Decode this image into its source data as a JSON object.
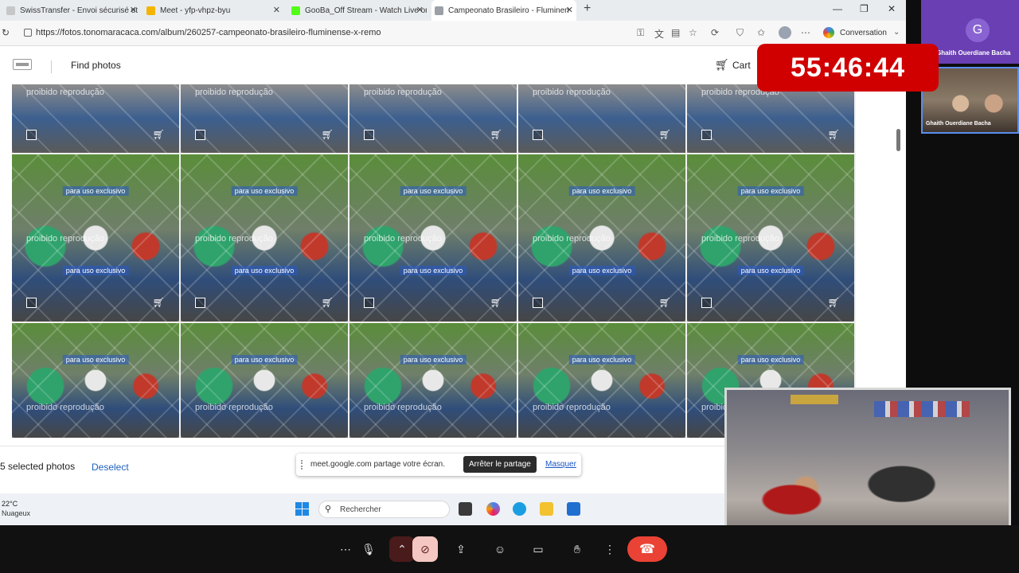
{
  "browser": {
    "tabs": [
      {
        "label": "SwissTransfer - Envoi sécurisé et g",
        "color": "#c7c7c7"
      },
      {
        "label": "Meet - yfp-vhpz-byu",
        "color": "#f4b400"
      },
      {
        "label": "GooBa_Off Stream - Watch Live on",
        "color": "#53fc18"
      },
      {
        "label": "Campeonato Brasileiro - Fluminen",
        "color": "#9aa0a6"
      }
    ],
    "url": "https://fotos.tonomaracaca.com/album/260257-campeonato-brasileiro-fluminense-x-remo",
    "conversation_label": "Conversation"
  },
  "site": {
    "find_photos": "Find photos",
    "cart": "Cart"
  },
  "gallery": {
    "watermark_excl": "para uso exclusivo",
    "watermark_prob": "proibido reprodução"
  },
  "selection": {
    "count_text": "5 selected photos",
    "deselect": "Deselect"
  },
  "sharebar": {
    "text": "meet.google.com partage votre écran.",
    "stop": "Arrêter le partage",
    "hide": "Masquer"
  },
  "taskbar": {
    "temp": "22°C",
    "weather": "Nuageux",
    "search_placeholder": "Rechercher"
  },
  "meet": {
    "participant_initial": "G",
    "participant_name": "Ghaith Ouerdiane Bacha",
    "video_name": "Ghaith Ouerdiane Bacha",
    "timer": "55:46:44",
    "end_call_color": "#ea4335"
  }
}
